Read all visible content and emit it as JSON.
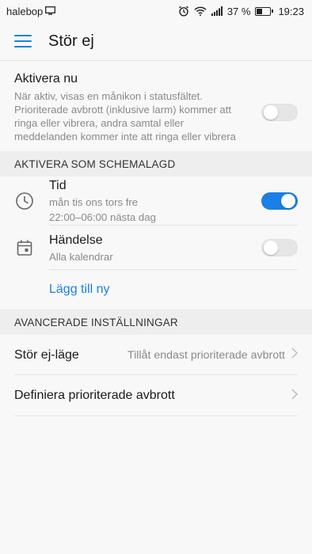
{
  "status_bar": {
    "carrier": "halebop",
    "battery_percent": "37 %",
    "time": "19:23",
    "battery_level": 0.37
  },
  "app_bar": {
    "title": "Stör ej",
    "menu_icon": "hamburger-menu-icon"
  },
  "activate_now": {
    "title": "Aktivera nu",
    "description": "När aktiv, visas en månikon i statusfältet. Prioriterade avbrott (inklusive larm) kommer att ringa eller vibrera, andra samtal eller meddelanden kommer inte att ringa eller vibrera",
    "enabled": false
  },
  "scheduled": {
    "header": "AKTIVERA SOM SCHEMALAGD",
    "time_rule": {
      "icon": "clock-icon",
      "title": "Tid",
      "days": "mån tis ons tors fre",
      "hours": "22:00–06:00 nästa dag",
      "enabled": true
    },
    "event_rule": {
      "icon": "calendar-icon",
      "title": "Händelse",
      "subtitle": "Alla kalendrar",
      "enabled": false
    },
    "add_new": "Lägg till ny"
  },
  "advanced": {
    "header": "AVANCERADE INSTÄLLNINGAR",
    "mode": {
      "label": "Stör ej-läge",
      "value": "Tillåt endast prioriterade avbrott"
    },
    "define_priority": {
      "label": "Definiera prioriterade avbrott"
    }
  },
  "colors": {
    "accent": "#1a7fe6",
    "background": "#f8f8f8",
    "section_header_bg": "#eeeeee",
    "secondary_text": "#8a8a8a"
  }
}
